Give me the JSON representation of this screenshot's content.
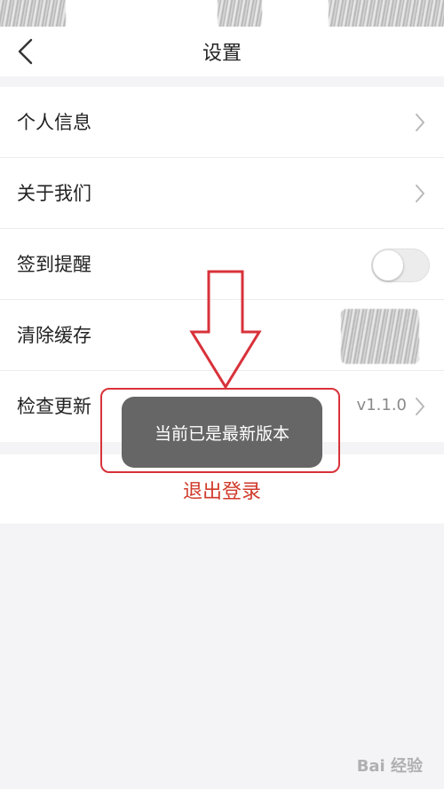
{
  "nav": {
    "title": "设置"
  },
  "settings": {
    "items": [
      {
        "label": "个人信息",
        "control": "chevron"
      },
      {
        "label": "关于我们",
        "control": "chevron"
      },
      {
        "label": "签到提醒",
        "control": "toggle",
        "enabled": false
      },
      {
        "label": "清除缓存",
        "control": "obscured"
      },
      {
        "label": "检查更新",
        "control": "chevron",
        "value": "v1.1.0"
      }
    ]
  },
  "logout": {
    "label": "退出登录",
    "color": "#d03a2a"
  },
  "toast": {
    "message": "当前已是最新版本"
  },
  "annotation": {
    "color": "#d8323a"
  },
  "watermark": {
    "text": "Bai  经验"
  }
}
